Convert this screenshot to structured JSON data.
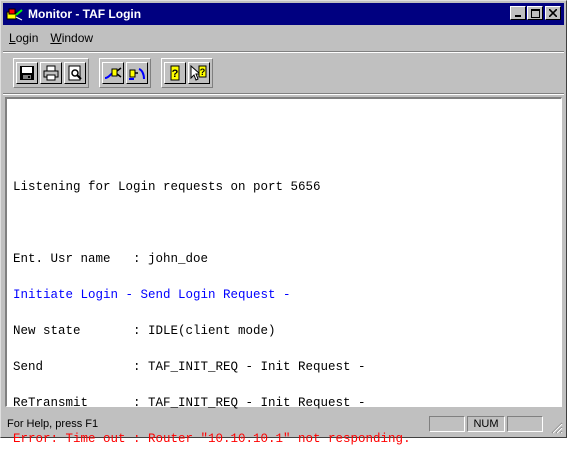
{
  "window": {
    "title": "Monitor - TAF Login"
  },
  "menu": {
    "items": [
      {
        "label": "Login",
        "underline": "L",
        "rest": "ogin"
      },
      {
        "label": "Window",
        "underline": "W",
        "rest": "indow"
      }
    ]
  },
  "toolbar": {
    "icons": [
      "save-icon",
      "print-icon",
      "print-preview-icon",
      "connect-icon",
      "disconnect-icon",
      "help-icon",
      "context-help-icon"
    ]
  },
  "log": {
    "lines": [
      {
        "text": "",
        "color": "#000000"
      },
      {
        "text": "Listening for Login requests on port 5656",
        "color": "#000000"
      },
      {
        "text": "",
        "color": "#000000"
      },
      {
        "text": "Ent. Usr name   : john_doe",
        "color": "#000000"
      },
      {
        "text": "Initiate Login - Send Login Request -",
        "color": "#0000ff"
      },
      {
        "text": "New state       : IDLE(client mode)",
        "color": "#000000"
      },
      {
        "text": "Send            : TAF_INIT_REQ - Init Request -",
        "color": "#000000"
      },
      {
        "text": "ReTransmit      : TAF_INIT_REQ - Init Request -",
        "color": "#000000"
      },
      {
        "text": "Error: Time out : Router \"10.10.10.1\" not responding.",
        "color": "#ff0000"
      }
    ]
  },
  "statusbar": {
    "help_text": "For Help, press F1",
    "num_indicator": "NUM"
  },
  "colors": {
    "titlebar": "#000080",
    "face": "#c0c0c0",
    "info_blue": "#0000ff",
    "error_red": "#ff0000"
  }
}
